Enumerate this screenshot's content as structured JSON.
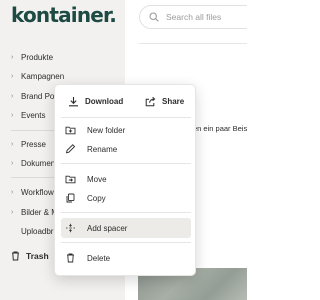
{
  "app": {
    "logo": "kontainer."
  },
  "sidebar": {
    "items": [
      {
        "label": "Produkte"
      },
      {
        "label": "Kampagnen"
      },
      {
        "label": "Brand Port"
      },
      {
        "label": "Events"
      },
      {
        "label": "Presse"
      },
      {
        "label": "Dokument"
      },
      {
        "label": "Workflows"
      },
      {
        "label": "Bilder & M"
      },
      {
        "label": "Uploadbr"
      }
    ],
    "trash_label": "Trash"
  },
  "search": {
    "placeholder": "Search all files"
  },
  "main": {
    "snippet": "en ein paar Beis"
  },
  "context_menu": {
    "download": "Download",
    "share": "Share",
    "new_folder": "New folder",
    "rename": "Rename",
    "move": "Move",
    "copy": "Copy",
    "add_spacer": "Add spacer",
    "delete": "Delete"
  },
  "icons": {
    "download": "download-icon",
    "share": "share-icon",
    "new_folder": "folder-plus-icon",
    "rename": "pencil-icon",
    "move": "folder-move-icon",
    "copy": "copy-icon",
    "add_spacer": "spacer-icon",
    "delete": "trash-icon",
    "search": "search-icon"
  },
  "colors": {
    "brand": "#1e4a44",
    "sidebar_bg": "#f2f1ef",
    "hover_bg": "#ecebe8"
  }
}
